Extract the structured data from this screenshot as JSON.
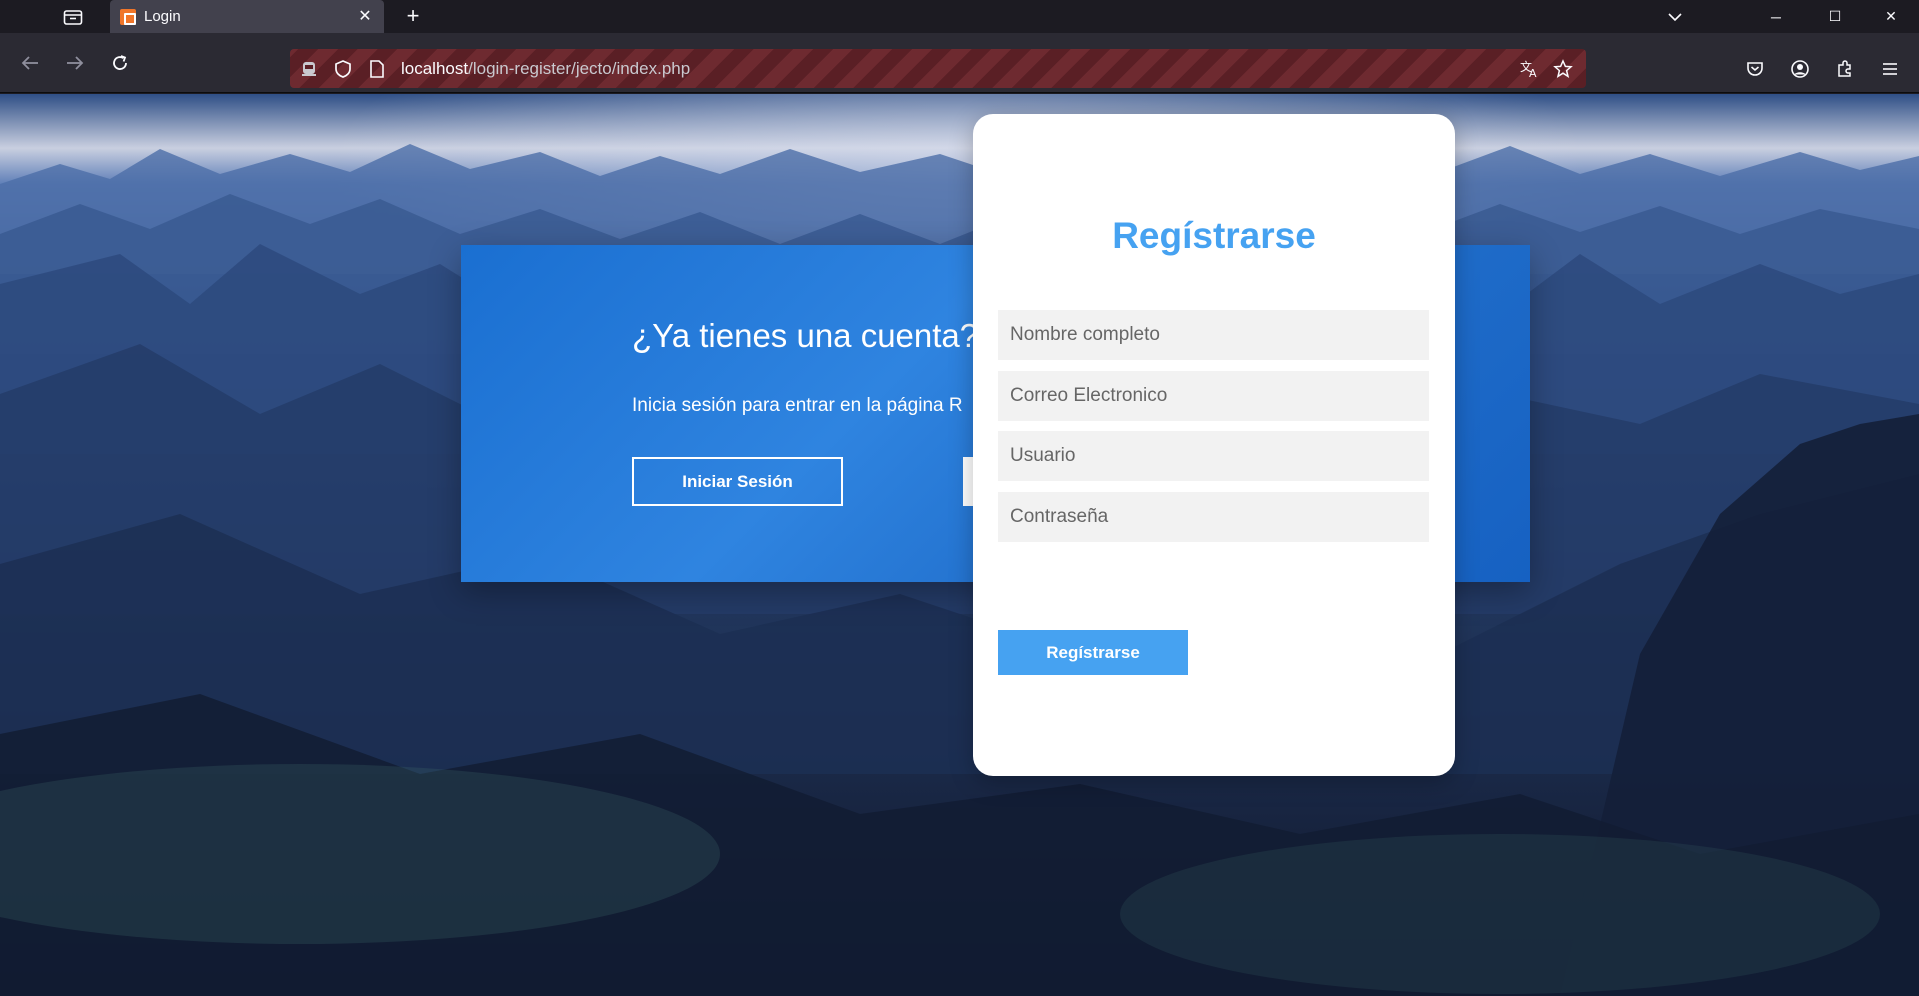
{
  "browser": {
    "tab_title": "Login",
    "tab_close": "✕",
    "new_tab": "+",
    "url_host": "localhost",
    "url_path": "/login-register/jecto/index.php",
    "controls": {
      "minimize": "─",
      "maximize": "☐",
      "close": "✕",
      "tab_list": "⌄"
    },
    "icons": [
      "tab-list-icon",
      "back-icon",
      "forward-icon",
      "reload-icon",
      "tracking-icon",
      "shield-icon",
      "page-icon",
      "translate-icon",
      "bookmark-star-icon",
      "pocket-icon",
      "account-icon",
      "extensions-icon",
      "menu-icon"
    ]
  },
  "login_panel": {
    "title": "¿Ya tienes una cuenta?¿",
    "text": "Inicia sesión para entrar en la página  R",
    "button": "Iniciar Sesión"
  },
  "register_form": {
    "title": "Regístrarse",
    "fields": {
      "fullname": {
        "placeholder": "Nombre completo"
      },
      "email": {
        "placeholder": "Correo Electronico"
      },
      "username": {
        "placeholder": "Usuario"
      },
      "password": {
        "placeholder": "Contraseña"
      }
    },
    "button": "Regístrarse"
  },
  "colors": {
    "accent": "#46a2f1",
    "panel_blue": "#1a6fd1",
    "chrome_dark": "#1c1b22"
  }
}
